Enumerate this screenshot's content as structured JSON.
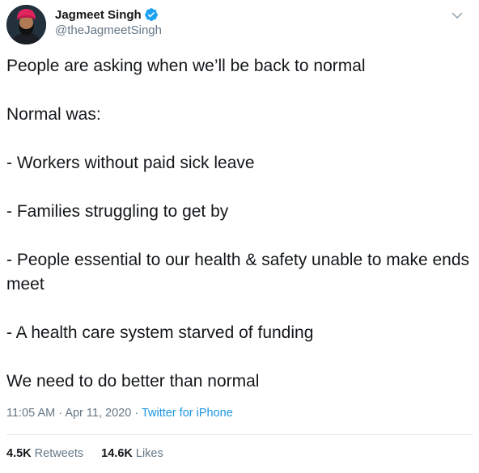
{
  "user": {
    "display_name": "Jagmeet Singh",
    "handle": "@theJagmeetSingh",
    "verified": true,
    "verified_color": "#1da1f2"
  },
  "tweet": {
    "lines": [
      "People are asking when we’ll be back to normal",
      "Normal was:",
      "- Workers without paid sick leave",
      "- Families struggling to get by",
      "- People essential to our health & safety unable to make ends meet",
      "- A health care system starved of funding",
      "We need to do better than normal"
    ]
  },
  "meta": {
    "time": "11:05 AM",
    "separator": "·",
    "date": "Apr 11, 2020",
    "source": "Twitter for iPhone"
  },
  "stats": {
    "retweets_count": "4.5K",
    "retweets_label": "Retweets",
    "likes_count": "14.6K",
    "likes_label": "Likes"
  },
  "icons": {
    "avatar": "profile-photo",
    "verified": "verified-badge-icon",
    "menu": "chevron-down-icon"
  },
  "colors": {
    "text": "#14171a",
    "secondary": "#657786",
    "link": "#1b95e0"
  }
}
